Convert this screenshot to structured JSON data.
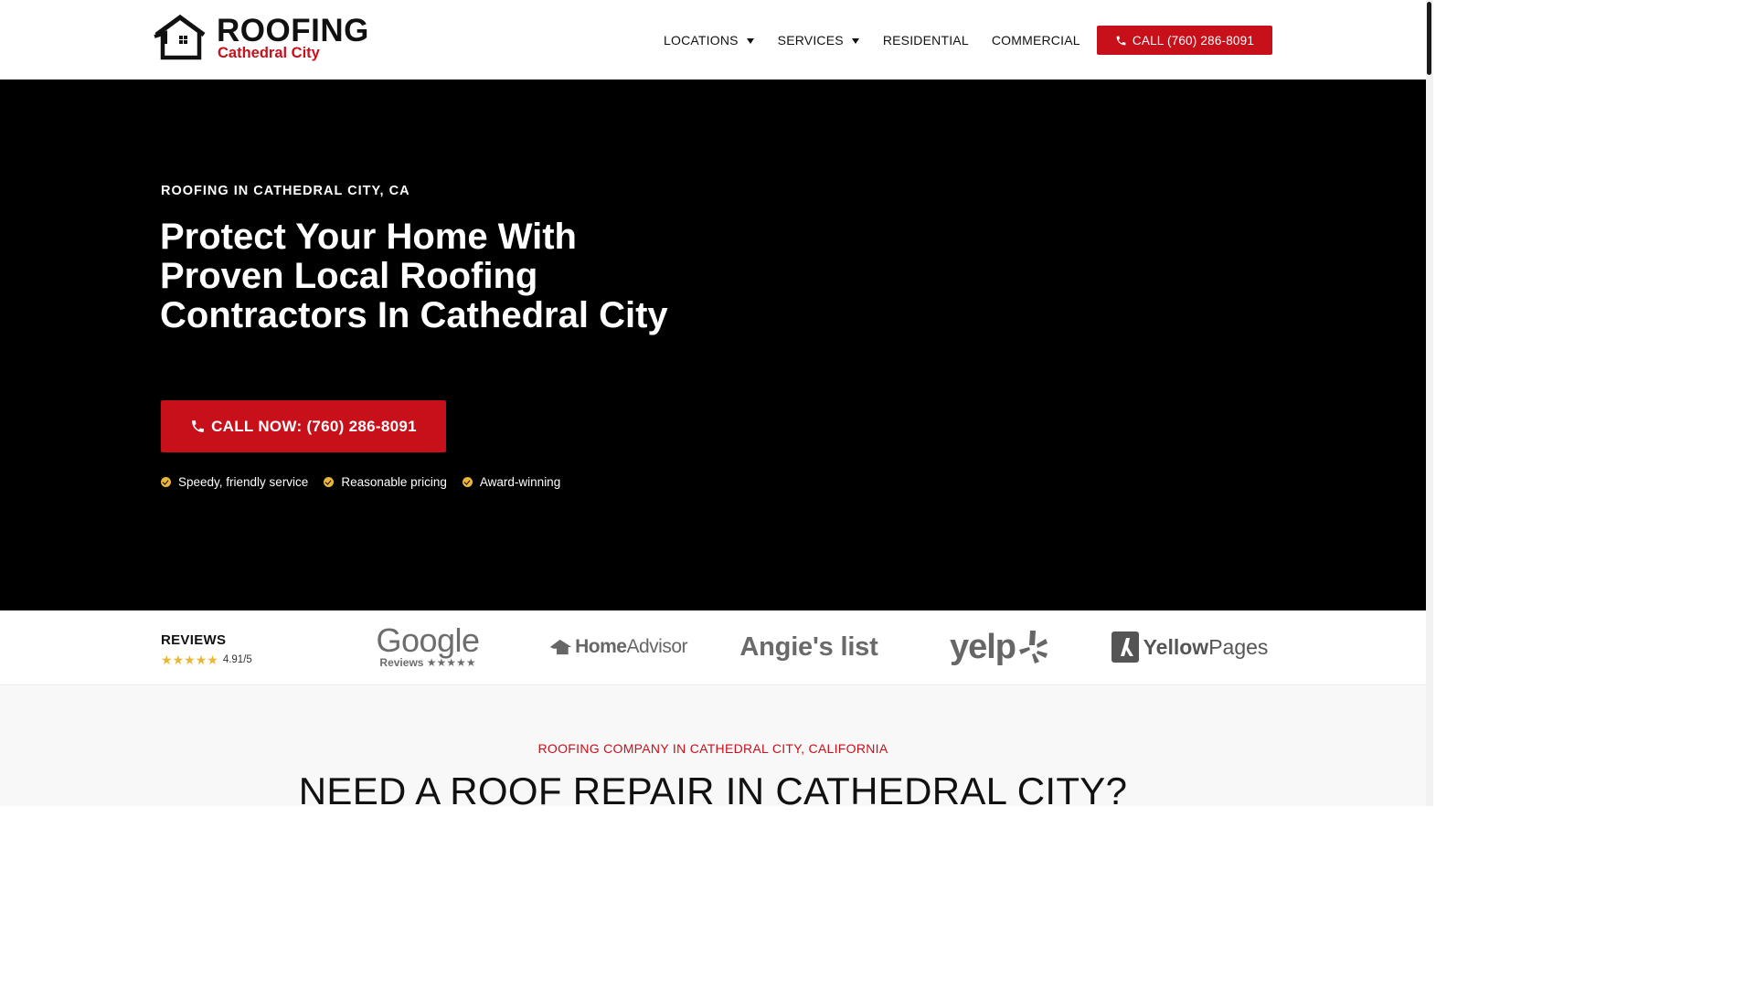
{
  "brand": {
    "title": "ROOFING",
    "subtitle": "Cathedral City"
  },
  "nav": {
    "items": [
      {
        "label": "LOCATIONS",
        "dropdown": true
      },
      {
        "label": "SERVICES",
        "dropdown": true
      },
      {
        "label": "RESIDENTIAL",
        "dropdown": false
      },
      {
        "label": "COMMERCIAL",
        "dropdown": false
      }
    ],
    "call_label": "CALL (760) 286-8091"
  },
  "hero": {
    "eyebrow": "ROOFING IN CATHEDRAL CITY, CA",
    "title": "Protect Your Home With Proven Local Roofing Contractors In Cathedral City",
    "cta_label": "CALL NOW: (760) 286-8091",
    "features": [
      "Speedy, friendly service",
      "Reasonable pricing",
      "Award-winning"
    ]
  },
  "reviews": {
    "label": "REVIEWS",
    "score": "4.91/5",
    "stars": 5,
    "brands": {
      "google": "Google",
      "google_sub": "Reviews ★★★★★",
      "homeadvisor_bold": "Home",
      "homeadvisor_regular": "Advisor",
      "angies": "Angie's list",
      "yelp": "yelp",
      "yellowpages_bold": "Yellow",
      "yellowpages_regular": "Pages"
    }
  },
  "section": {
    "eyebrow": "ROOFING COMPANY IN CATHEDRAL CITY, CALIFORNIA",
    "title": "NEED A ROOF REPAIR IN CATHEDRAL CITY?"
  },
  "colors": {
    "accent": "#c8101b",
    "check": "#e9b637",
    "hero_bg": "#000000"
  }
}
